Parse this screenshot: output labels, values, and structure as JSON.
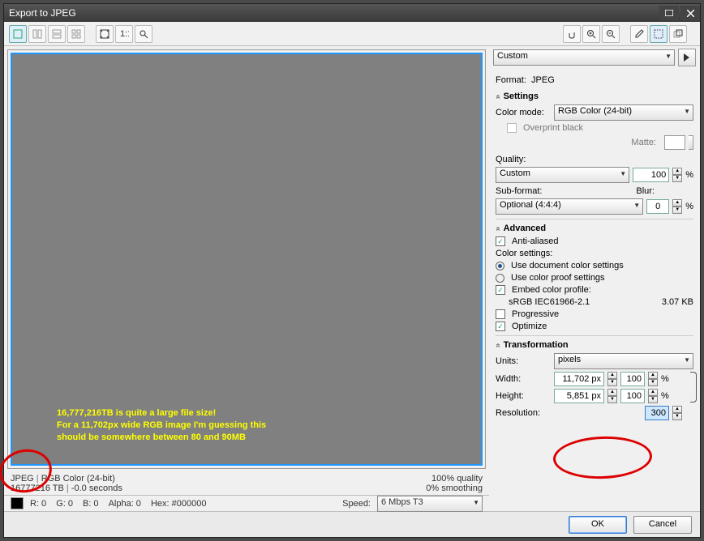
{
  "titlebar": {
    "title": "Export to JPEG"
  },
  "preset": {
    "value": "Custom"
  },
  "format": {
    "label": "Format:",
    "value": "JPEG"
  },
  "sections": {
    "settings": "Settings",
    "advanced": "Advanced",
    "transformation": "Transformation"
  },
  "settings": {
    "colormode_label": "Color mode:",
    "colormode_value": "RGB Color (24-bit)",
    "overprint": "Overprint black",
    "matte_label": "Matte:",
    "quality_label": "Quality:",
    "quality_select": "Custom",
    "quality_value": "100",
    "pct": "%",
    "subformat_label": "Sub-format:",
    "subformat_value": "Optional (4:4:4)",
    "blur_label": "Blur:",
    "blur_value": "0"
  },
  "advanced": {
    "antialiased": "Anti-aliased",
    "colorsettings": "Color settings:",
    "use_doc": "Use document color settings",
    "use_proof": "Use color proof settings",
    "embed": "Embed color profile:",
    "profile": "sRGB IEC61966-2.1",
    "profile_size": "3.07 KB",
    "progressive": "Progressive",
    "optimize": "Optimize"
  },
  "transformation": {
    "units_label": "Units:",
    "units_value": "pixels",
    "width_label": "Width:",
    "width_px": "11,702 px",
    "width_pct": "100",
    "height_label": "Height:",
    "height_px": "5,851 px",
    "height_pct": "100",
    "resolution_label": "Resolution:",
    "resolution_value": "300",
    "pct": "%"
  },
  "status": {
    "line1_a": "JPEG",
    "line1_sep": "|",
    "line1_b": "RGB Color (24-bit)",
    "line2_a": "16777216 TB",
    "line2_b": "-0.0 seconds",
    "right1": "100% quality",
    "right2": "0% smoothing"
  },
  "colorbar": {
    "r": "R: 0",
    "g": "G: 0",
    "b": "B: 0",
    "alpha": "Alpha: 0",
    "hex": "Hex: #000000",
    "speed_label": "Speed:",
    "speed_value": "6 Mbps T3"
  },
  "annotation": {
    "l1": "16,777,216TB is quite a large file size!",
    "l2": "For a 11,702px wide RGB image I'm guessing this",
    "l3": "should be somewhere between 80 and 90MB"
  },
  "footer": {
    "ok": "OK",
    "cancel": "Cancel"
  }
}
